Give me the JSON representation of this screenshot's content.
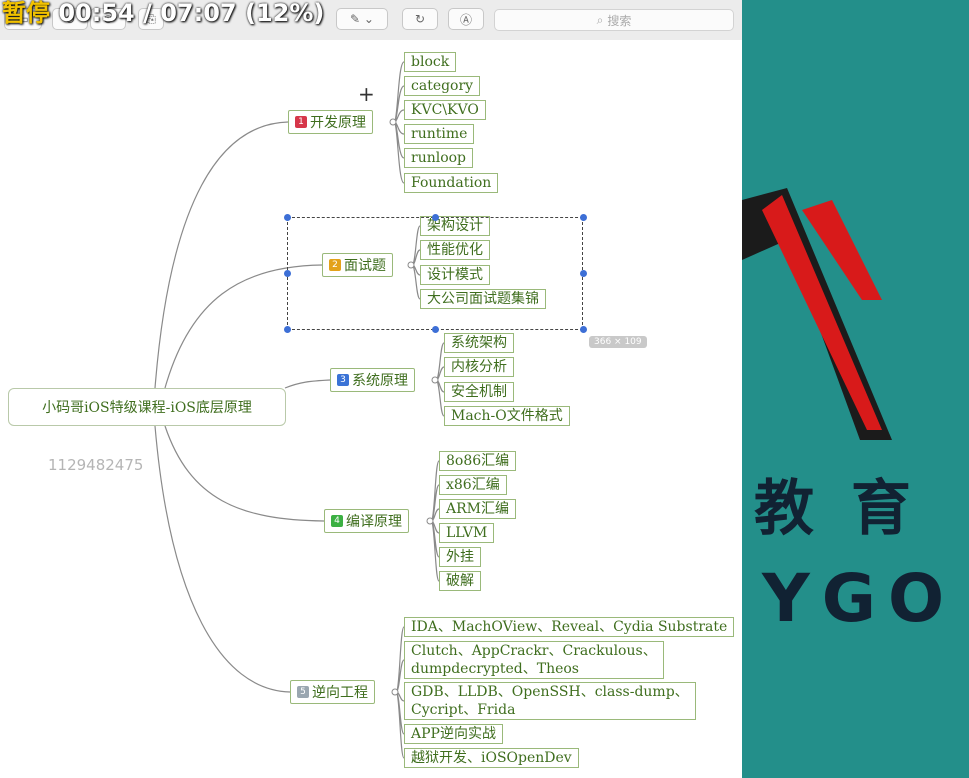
{
  "overlay": {
    "paused_label": "暂停",
    "time_text": "00:54 / 07:07 (12%)"
  },
  "toolbar": {
    "search_placeholder": "搜索"
  },
  "mindmap": {
    "root": "小码哥iOS特级课程-iOS底层原理",
    "branches": [
      {
        "number": "1",
        "label": "开发原理",
        "color": "#d6364a",
        "leaves": [
          "block",
          "category",
          "KVC\\KVO",
          "runtime",
          "runloop",
          "Foundation"
        ]
      },
      {
        "number": "2",
        "label": "面试题",
        "color": "#e3a21a",
        "leaves": [
          "架构设计",
          "性能优化",
          "设计模式",
          "大公司面试题集锦"
        ]
      },
      {
        "number": "3",
        "label": "系统原理",
        "color": "#3b73d6",
        "leaves": [
          "系统架构",
          "内核分析",
          "安全机制",
          "Mach-O文件格式"
        ]
      },
      {
        "number": "4",
        "label": "编译原理",
        "color": "#3cb043",
        "leaves": [
          "8o86汇编",
          "x86汇编",
          "ARM汇编",
          "LLVM",
          "外挂",
          "破解"
        ]
      },
      {
        "number": "5",
        "label": "逆向工程",
        "color": "#9aa6b0",
        "leaves": [
          "IDA、MachOView、Reveal、Cydia Substrate",
          "Clutch、AppCrackr、Crackulous、|dumpdecrypted、Theos",
          "GDB、LLDB、OpenSSH、class-dump、|Cycript、Frida",
          "APP逆向实战",
          "越狱开发、iOSOpenDev"
        ]
      }
    ]
  },
  "canvas": {
    "watermark_number": "1129482475",
    "selection_size": "366 × 109"
  },
  "brand": {
    "chinese": "教 育",
    "latin": "YGO"
  }
}
